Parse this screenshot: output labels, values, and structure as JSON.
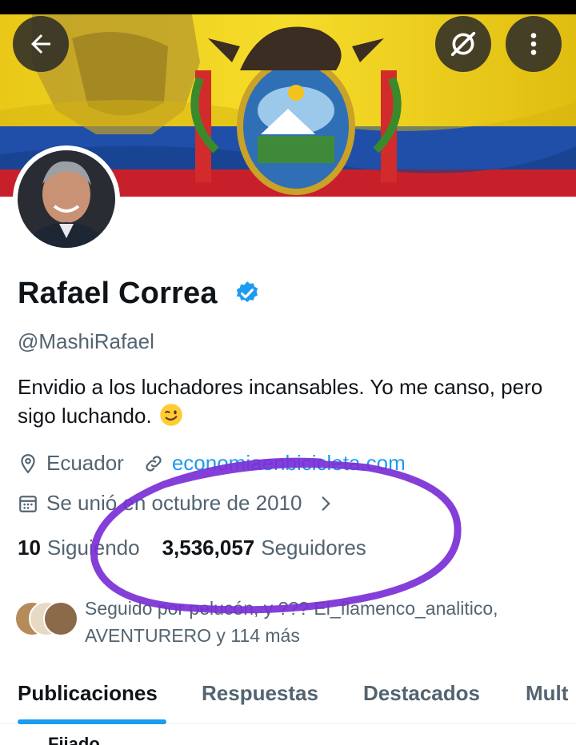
{
  "header": {
    "back_icon": "arrow-left-icon",
    "sat_icon": "satellite-off-icon",
    "more_icon": "more-vertical-icon"
  },
  "profile": {
    "name": "Rafael Correa",
    "handle": "@MashiRafael",
    "bio": "Envidio a los luchadores incansables. Yo me canso, pero sigo luchando.",
    "location": "Ecuador",
    "website": "economiaenbicicleta.com",
    "joined": "Se unió en octubre de 2010",
    "following_count": "10",
    "following_label": "Siguiendo",
    "followers_count": "3,536,057",
    "followers_label": "Seguidores",
    "followed_by": "Seguido por pelucón, y ??? El_flamenco_analitico, AVENTURERO y 114 más"
  },
  "tabs": [
    {
      "label": "Publicaciones",
      "active": true
    },
    {
      "label": "Respuestas",
      "active": false
    },
    {
      "label": "Destacados",
      "active": false
    },
    {
      "label": "Mult",
      "active": false
    }
  ],
  "peek_text": "Fijado",
  "colors": {
    "accent": "#1d9bf0",
    "annotation": "#7b2fd6",
    "text_primary": "#0f1419",
    "text_secondary": "#536471"
  }
}
